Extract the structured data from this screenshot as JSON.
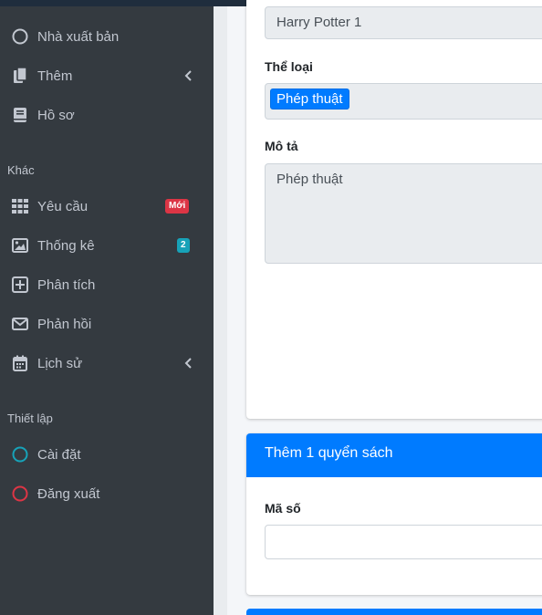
{
  "sidebar": {
    "items_top": [
      {
        "label": "Nhà xuất bản",
        "icon": "circle-outline-icon"
      },
      {
        "label": "Thêm",
        "icon": "copy-icon",
        "has_chevron": true
      },
      {
        "label": "Hồ sơ",
        "icon": "book-icon"
      }
    ],
    "section_other": "Khác",
    "items_other": [
      {
        "label": "Yêu cầu",
        "icon": "grid-icon",
        "badge": "Mới",
        "badge_color": "#dc3545"
      },
      {
        "label": "Thống kê",
        "icon": "image-icon",
        "badge": "2",
        "badge_color": "#17a2b8"
      },
      {
        "label": "Phân tích",
        "icon": "plus-square-icon"
      },
      {
        "label": "Phản hồi",
        "icon": "envelope-icon"
      },
      {
        "label": "Lịch sử",
        "icon": "calendar-icon",
        "has_chevron": true
      }
    ],
    "section_settings": "Thiết lập",
    "items_settings": [
      {
        "label": "Cài đặt",
        "icon": "circle-teal-icon",
        "color": "#17a2b8"
      },
      {
        "label": "Đăng xuất",
        "icon": "circle-red-icon",
        "color": "#dc3545"
      }
    ]
  },
  "book_form": {
    "name_value": "Harry Potter 1",
    "genre_label": "Thể loại",
    "genre_tag": "Phép thuật",
    "description_label": "Mô tả",
    "description_value": "Phép thuật"
  },
  "add_book_card": {
    "title": "Thêm 1 quyển sách",
    "code_label": "Mã số",
    "code_value": ""
  },
  "colors": {
    "sidebar_bg": "#343a40",
    "primary": "#007bff",
    "danger": "#dc3545",
    "info": "#17a2b8"
  }
}
